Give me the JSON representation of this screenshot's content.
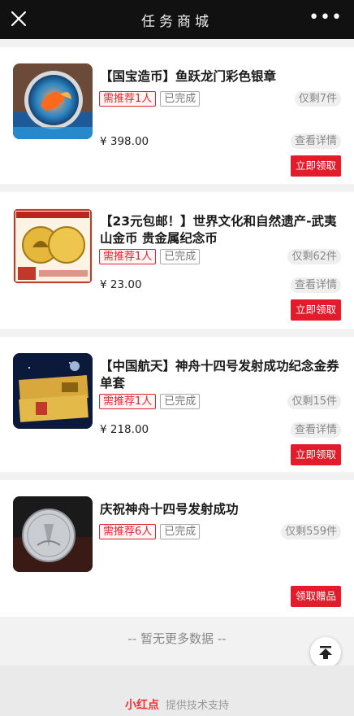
{
  "header": {
    "title": "任务商城",
    "close_icon": "close-icon",
    "more_icon": "more-icon",
    "more_label": "•••"
  },
  "products": [
    {
      "name": "【国宝造币】鱼跃龙门彩色银章",
      "recommend": "需推荐1人",
      "status": "已完成",
      "stock": "仅剩7件",
      "price": "¥ 398.00",
      "detail": "查看详情",
      "action": "立即领取"
    },
    {
      "name": "【23元包邮！】世界文化和自然遗产-武夷山金币 贵金属纪念币",
      "recommend": "需推荐1人",
      "status": "已完成",
      "stock": "仅剩62件",
      "price": "¥ 23.00",
      "detail": "查看详情",
      "action": "立即领取"
    },
    {
      "name": "【中国航天】神舟十四号发射成功纪念金券单套",
      "recommend": "需推荐1人",
      "status": "已完成",
      "stock": "仅剩15件",
      "price": "¥ 218.00",
      "detail": "查看详情",
      "action": "立即领取"
    },
    {
      "name": "庆祝神舟十四号发射成功",
      "recommend": "需推荐6人",
      "status": "已完成",
      "stock": "仅剩559件",
      "action": "领取赠品"
    }
  ],
  "no_more": "-- 暂无更多数据 --",
  "footer": {
    "brand": "小红点",
    "text": "提供技术支持"
  },
  "colors": {
    "accent": "#e31b2a",
    "topbar": "#111111"
  }
}
